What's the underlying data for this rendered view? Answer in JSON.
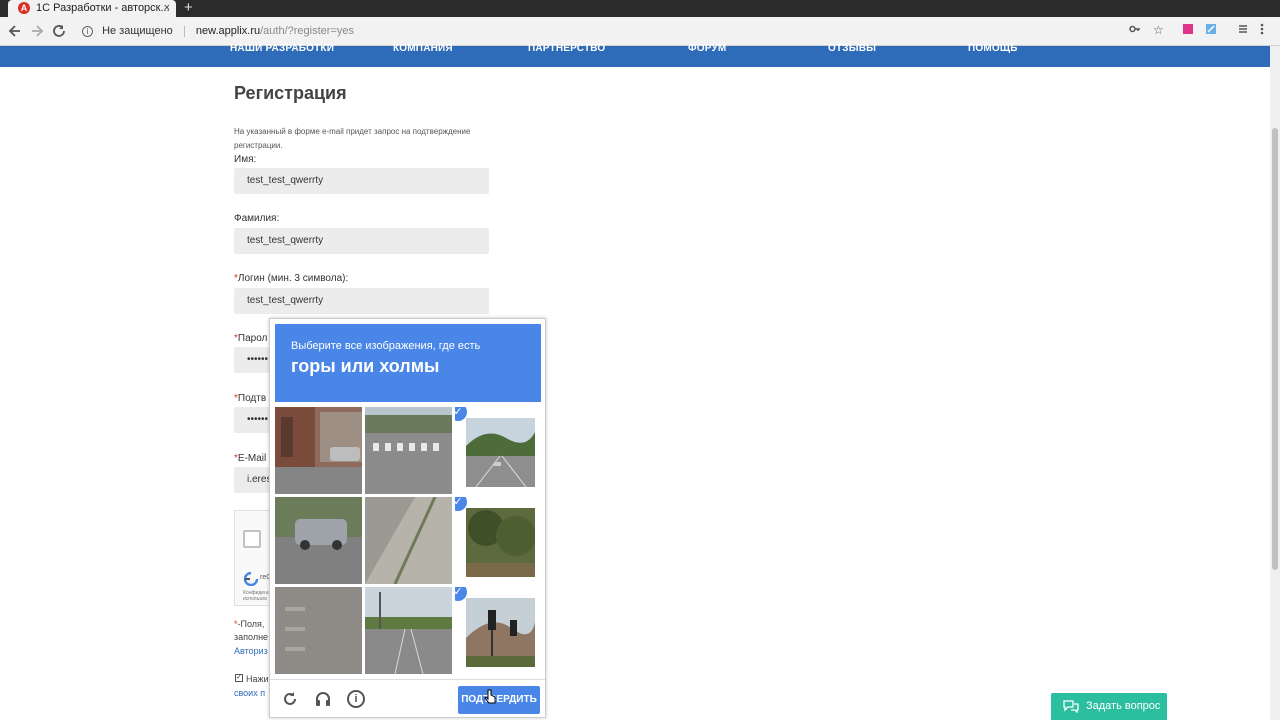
{
  "browser": {
    "tab_title": "1С Разработки - авторск...",
    "tab_close": "×",
    "new_tab": "+",
    "security_label": "Не защищено",
    "url_host": "new.applix.ru",
    "url_path": "/auth/?register=yes",
    "icons": [
      "back-icon",
      "forward-icon",
      "reload-icon",
      "info-icon",
      "key-icon",
      "star-icon",
      "extension-icon",
      "menu-icon"
    ]
  },
  "site_nav": {
    "items": [
      "НАШИ РАЗРАБОТКИ",
      "КОМПАНИЯ",
      "ПАРТНЕРСТВО",
      "ФОРУМ",
      "ОТЗЫВЫ",
      "ПОМОЩЬ"
    ]
  },
  "form": {
    "title": "Регистрация",
    "note": "На указанный в форме e-mail придет запрос на подтверждение регистрации.",
    "required_mark": "*",
    "fields": [
      {
        "label": "Имя:",
        "value": "test_test_qwerrty"
      },
      {
        "label": "Фамилия:",
        "value": "test_test_qwerrty"
      },
      {
        "label": "Логин (мин. 3 символа):",
        "value": "test_test_qwerrty"
      },
      {
        "label": "Парол",
        "value": "••••••"
      },
      {
        "label": "Подтв",
        "value": "••••••"
      },
      {
        "label": "E-Mail",
        "value": "i.eres"
      }
    ],
    "recaptcha_badge": "reC",
    "recaptcha_small": "Конфиденц. использов",
    "footnote_1": "-Поля,",
    "footnote_2": "заполне",
    "auth_link": "Авториз",
    "agree_text": "Нажи",
    "agree_link": "своих п"
  },
  "challenge": {
    "subtitle": "Выберите все изображения, где есть",
    "main": "горы или холмы",
    "verify_label": "ПОДТВЕРДИТЬ",
    "tiles": [
      {
        "selected": false,
        "scene": "brick building with parked car"
      },
      {
        "selected": false,
        "scene": "road with crosswalk"
      },
      {
        "selected": true,
        "scene": "highway with green hills"
      },
      {
        "selected": false,
        "scene": "silver SUV on street"
      },
      {
        "selected": false,
        "scene": "sidewalk and road"
      },
      {
        "selected": true,
        "scene": "trees and hillside"
      },
      {
        "selected": false,
        "scene": "crosswalk pavement"
      },
      {
        "selected": false,
        "scene": "road with poles"
      },
      {
        "selected": true,
        "scene": "traffic light with hills"
      }
    ]
  },
  "chat": {
    "label": "Задать вопрос"
  },
  "colors": {
    "nav_blue": "#2e6bb8",
    "recaptcha_blue": "#4a86e8",
    "chat_green": "#2bbfa0",
    "required_red": "#d93025"
  }
}
